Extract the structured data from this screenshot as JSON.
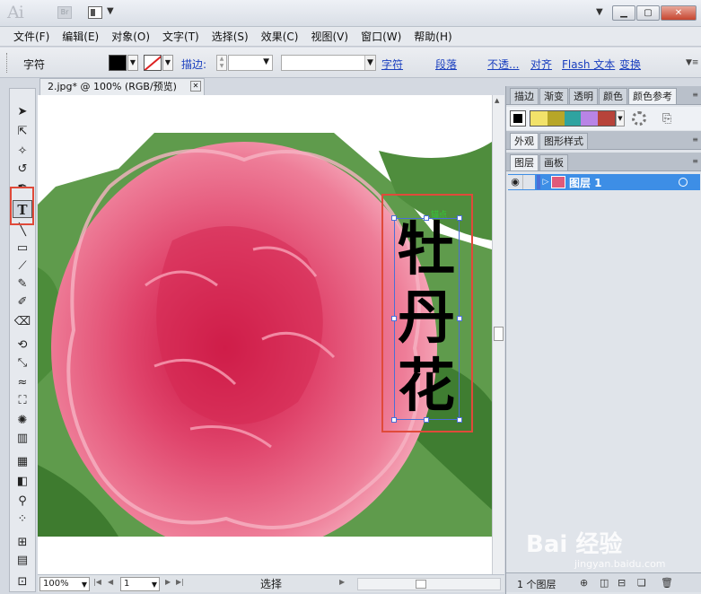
{
  "titlebar": {
    "app_logo": "Ai",
    "bridge": "Br",
    "window_buttons": [
      "▁",
      "▢",
      "✕"
    ]
  },
  "menu": [
    "文件(F)",
    "编辑(E)",
    "对象(O)",
    "文字(T)",
    "选择(S)",
    "效果(C)",
    "视图(V)",
    "窗口(W)",
    "帮助(H)"
  ],
  "control": {
    "context": "字符",
    "stroke_label": "描边:",
    "links": [
      "字符",
      "段落",
      "不透...",
      "对齐",
      "Flash 文本",
      "变换"
    ],
    "colors": {
      "fill": "#000000",
      "stroke_none": "#d22222"
    }
  },
  "document": {
    "tab_title": "2.jpg* @ 100% (RGB/预览)",
    "anchor_label": "锚点",
    "artwork_glyphs": [
      "牡",
      "丹",
      "花"
    ],
    "artwork_icon": "peony-photo"
  },
  "tools": [
    "selection-icon",
    "direct-selection-icon",
    "magic-wand-icon",
    "lasso-icon",
    "pen-icon",
    "type-icon",
    "line-icon",
    "rectangle-icon",
    "paintbrush-icon",
    "pencil-icon",
    "blob-brush-icon",
    "eraser-icon",
    "rotate-icon",
    "scale-icon",
    "warp-icon",
    "free-transform-icon",
    "symbol-sprayer-icon",
    "graph-icon",
    "mesh-icon",
    "gradient-icon",
    "eyedropper-icon",
    "blend-icon",
    "artboard-icon",
    "slice-icon",
    "hand-icon",
    "zoom-icon"
  ],
  "status": {
    "zoom": "100%",
    "page": "1",
    "mode": "选择"
  },
  "panels": {
    "top_tabs": [
      "描边",
      "渐变",
      "透明",
      "颜色",
      "颜色参考"
    ],
    "guide_colors": [
      "#f2e26a",
      "#b7a628",
      "#2fa3a0",
      "#b884e6",
      "#b7433a"
    ],
    "mid_tabs": [
      "外观",
      "图形样式"
    ],
    "layer_tabs": [
      "图层",
      "画板"
    ],
    "layer_name": "图层 1",
    "layers_count": "1 个图层"
  },
  "watermark": {
    "text": "Bai 经验",
    "sub": "jingyan.baidu.com"
  }
}
